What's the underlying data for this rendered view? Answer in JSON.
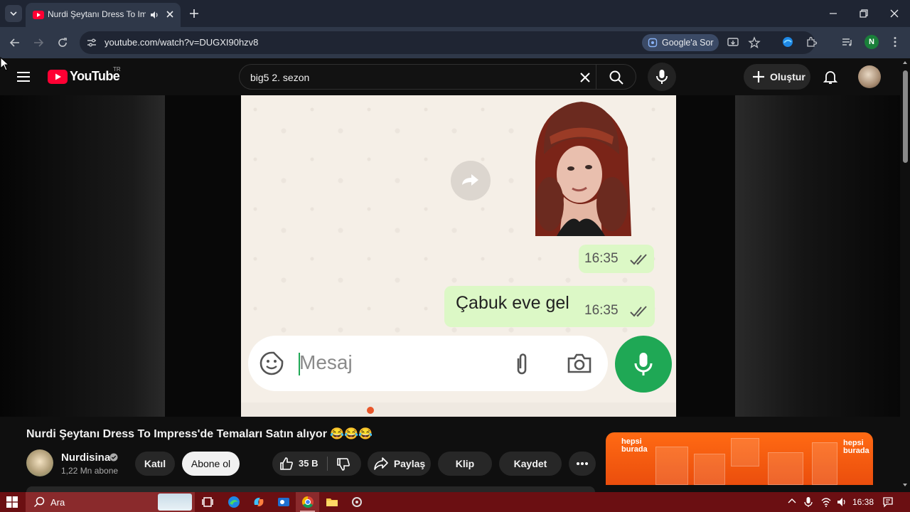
{
  "browser": {
    "tab_title": "Nurdi Şeytanı Dress To Impr",
    "url": "youtube.com/watch?v=DUGXI90hzv8",
    "ask_google": "Google'a Sor",
    "profile_initial": "N"
  },
  "youtube": {
    "logo_text": "YouTube",
    "region": "TR",
    "search_query": "big5 2. sezon",
    "create_label": "Oluştur"
  },
  "video_frame": {
    "time_1": "16:35",
    "message_text": "Çabuk eve gel",
    "time_2": "16:35",
    "composer_placeholder": "Mesaj"
  },
  "video": {
    "title": "Nurdi Şeytanı Dress To Impress'de Temaları Satın alıyor 😂😂😂",
    "channel_name": "Nurdisina",
    "subscribers": "1,22 Mn abone",
    "join_label": "Katıl",
    "subscribe_label": "Abone ol",
    "likes": "35 B",
    "share_label": "Paylaş",
    "clip_label": "Klip",
    "save_label": "Kaydet"
  },
  "ad": {
    "brand_line1": "hepsi",
    "brand_line2": "burada"
  },
  "taskbar": {
    "search_label": "Ara",
    "time": "16:38"
  },
  "colors": {
    "youtube_red": "#ff0033",
    "whatsapp_green": "#1fa855",
    "bubble_green": "#dcf8c6",
    "ad_orange": "#ff6a13",
    "taskbar": "#6b0f12"
  }
}
